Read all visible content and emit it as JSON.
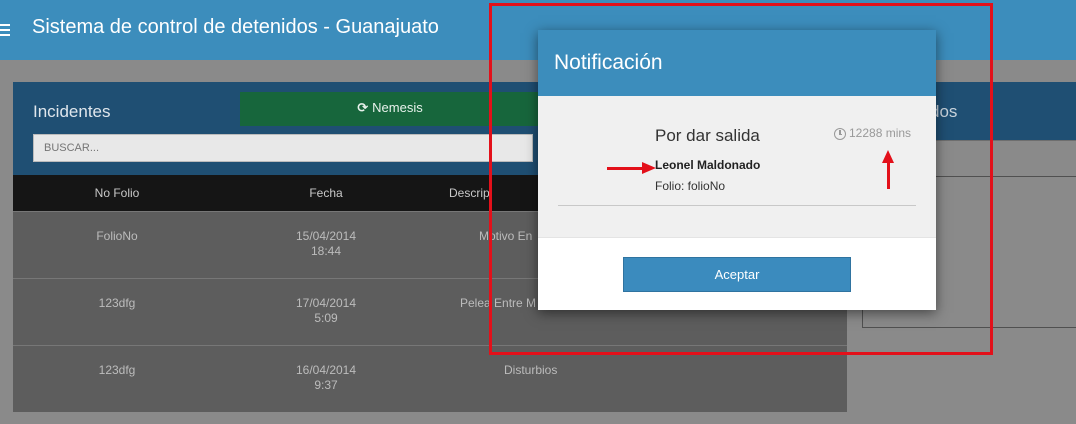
{
  "app": {
    "title": "Sistema de control de detenidos - Guanajuato"
  },
  "incidents": {
    "title": "Incidentes",
    "nemesis_label": "Nemesis",
    "search_placeholder": "BUSCAR...",
    "columns": [
      "No Folio",
      "Fecha",
      "Descrip"
    ],
    "rows": [
      {
        "folio": "FolioNo",
        "date": "15/04/2014",
        "time": "18:44",
        "description": "Motivo En"
      },
      {
        "folio": "123dfg",
        "date": "17/04/2014",
        "time": "5:09",
        "description": "Pelea Entre M"
      },
      {
        "folio": "123dfg",
        "date": "16/04/2014",
        "time": "9:37",
        "description": "Disturbios"
      }
    ]
  },
  "right_panel": {
    "label": "dos"
  },
  "modal": {
    "title": "Notificación",
    "heading": "Por dar salida",
    "time": "12288 mins",
    "name": "Leonel Maldonado",
    "folio": "Folio: folioNo",
    "accept_label": "Aceptar"
  },
  "colors": {
    "primary": "#3c8dbc",
    "accent_green": "#17663c",
    "annotation_red": "#e3101a"
  }
}
